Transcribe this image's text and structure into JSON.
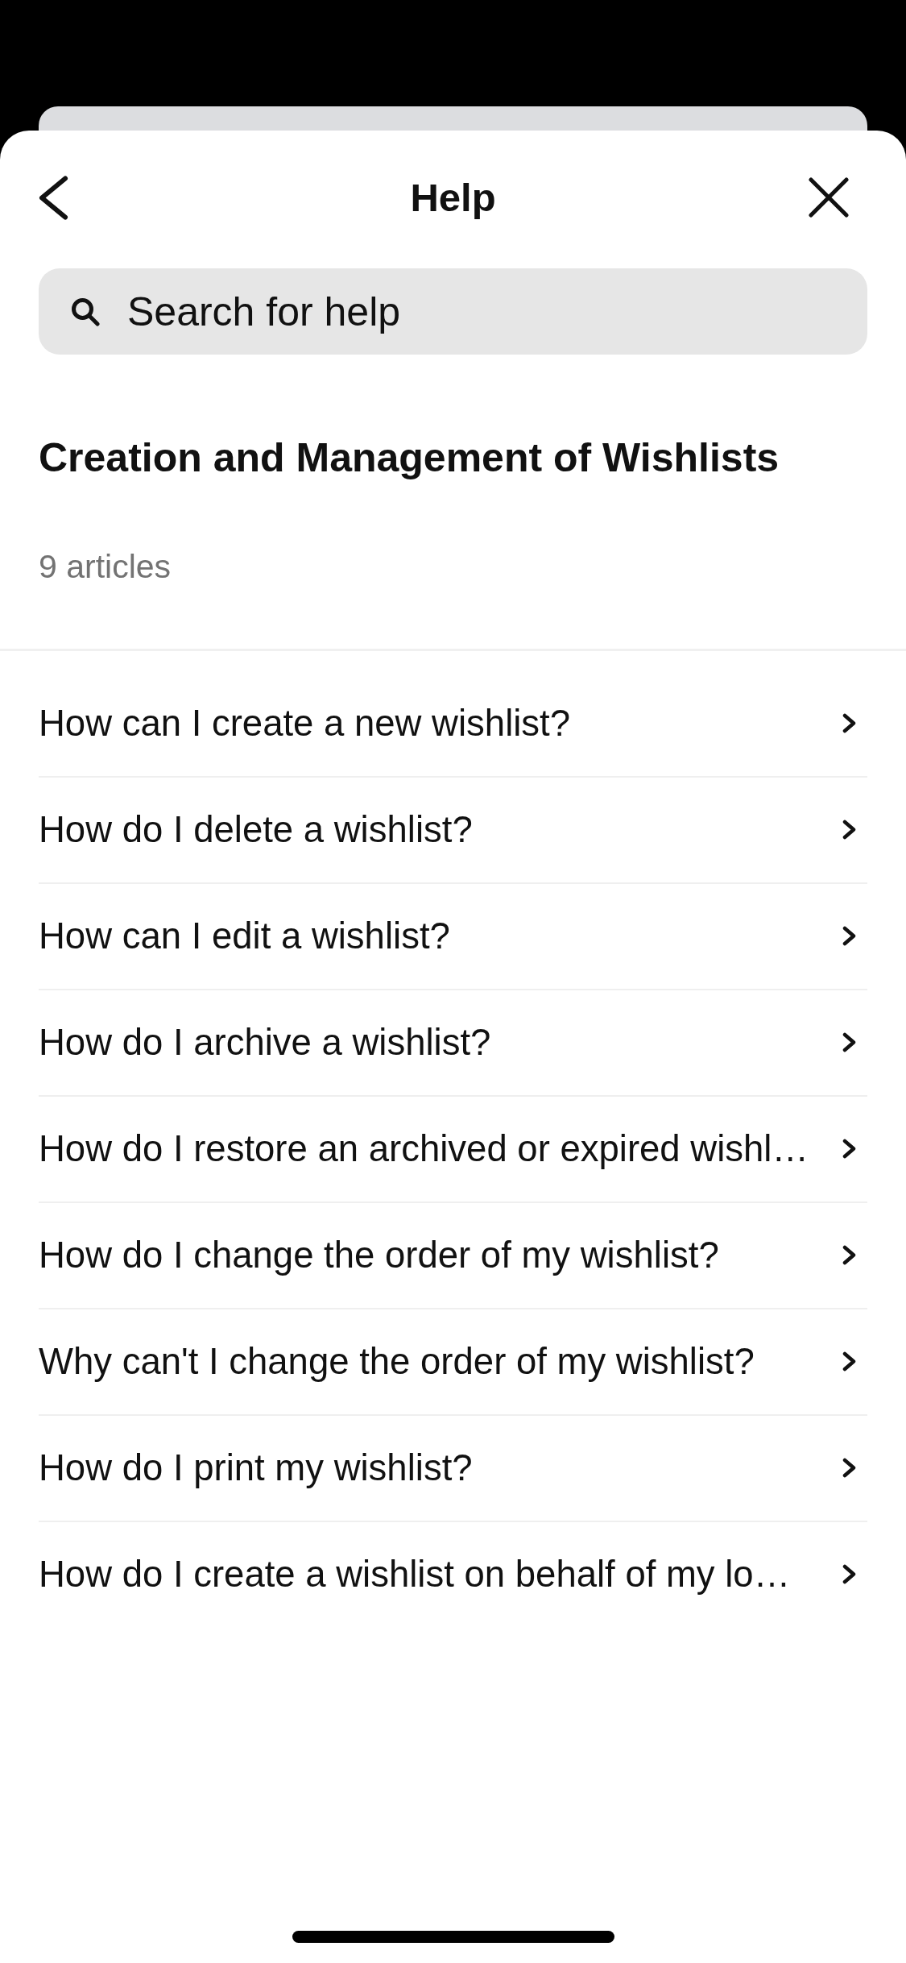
{
  "header": {
    "title": "Help"
  },
  "search": {
    "placeholder": "Search for help"
  },
  "category": {
    "title": "Creation and Management of Wishlists",
    "article_count": "9 articles"
  },
  "articles": [
    {
      "title": "How can I create a new wishlist?"
    },
    {
      "title": "How do I delete a wishlist?"
    },
    {
      "title": "How can I edit a wishlist?"
    },
    {
      "title": "How do I archive a wishlist?"
    },
    {
      "title": "How do I restore an archived or expired wishl…"
    },
    {
      "title": "How do I change the order of my wishlist?"
    },
    {
      "title": "Why can't I change the order of my wishlist?"
    },
    {
      "title": "How do I print my wishlist?"
    },
    {
      "title": "How do I create a wishlist on behalf of my lo…"
    }
  ]
}
